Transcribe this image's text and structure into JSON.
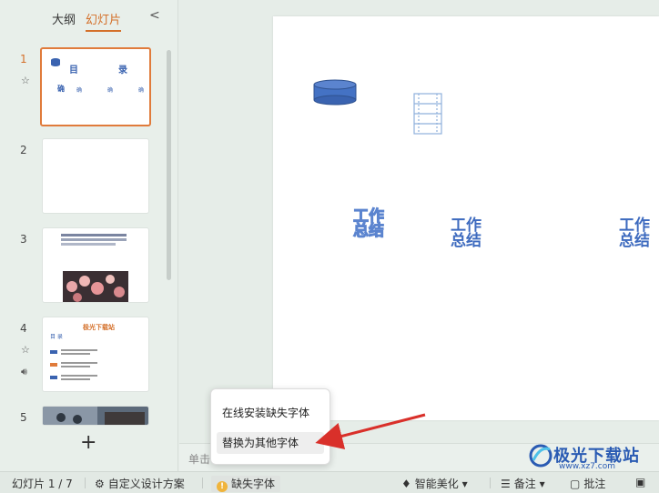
{
  "sidebar": {
    "tabs": [
      {
        "label": "大纲"
      },
      {
        "label": "幻灯片"
      }
    ],
    "collapse_glyph": "<",
    "slides": [
      {
        "num": "1",
        "title_left": "目",
        "title_right": "录",
        "labels": [
          "确",
          "确",
          "确",
          "确"
        ]
      },
      {
        "num": "2"
      },
      {
        "num": "3"
      },
      {
        "num": "4",
        "heading": "极光下载站",
        "toc": "目 录"
      },
      {
        "num": "5"
      }
    ],
    "add_glyph": "+"
  },
  "slide_canvas": {
    "text1": "工作总结",
    "text2": "工作总结",
    "text3": "工作总结"
  },
  "notes_placeholder": "单击",
  "popup": {
    "items": [
      {
        "label": "在线安装缺失字体"
      },
      {
        "label": "替换为其他字体"
      }
    ]
  },
  "status_bar": {
    "slide_counter": "幻灯片 1 / 7",
    "custom_design": "自定义设计方案",
    "missing_font": "缺失字体",
    "smart_beautify": "智能美化",
    "notes": "备注",
    "comments": "批注"
  },
  "watermark": {
    "name": "极光下载站",
    "url": "www.xz7.com"
  },
  "colors": {
    "accent": "#d4702a",
    "slide_text": "#3e6bbf",
    "arrow": "#d9302a"
  }
}
